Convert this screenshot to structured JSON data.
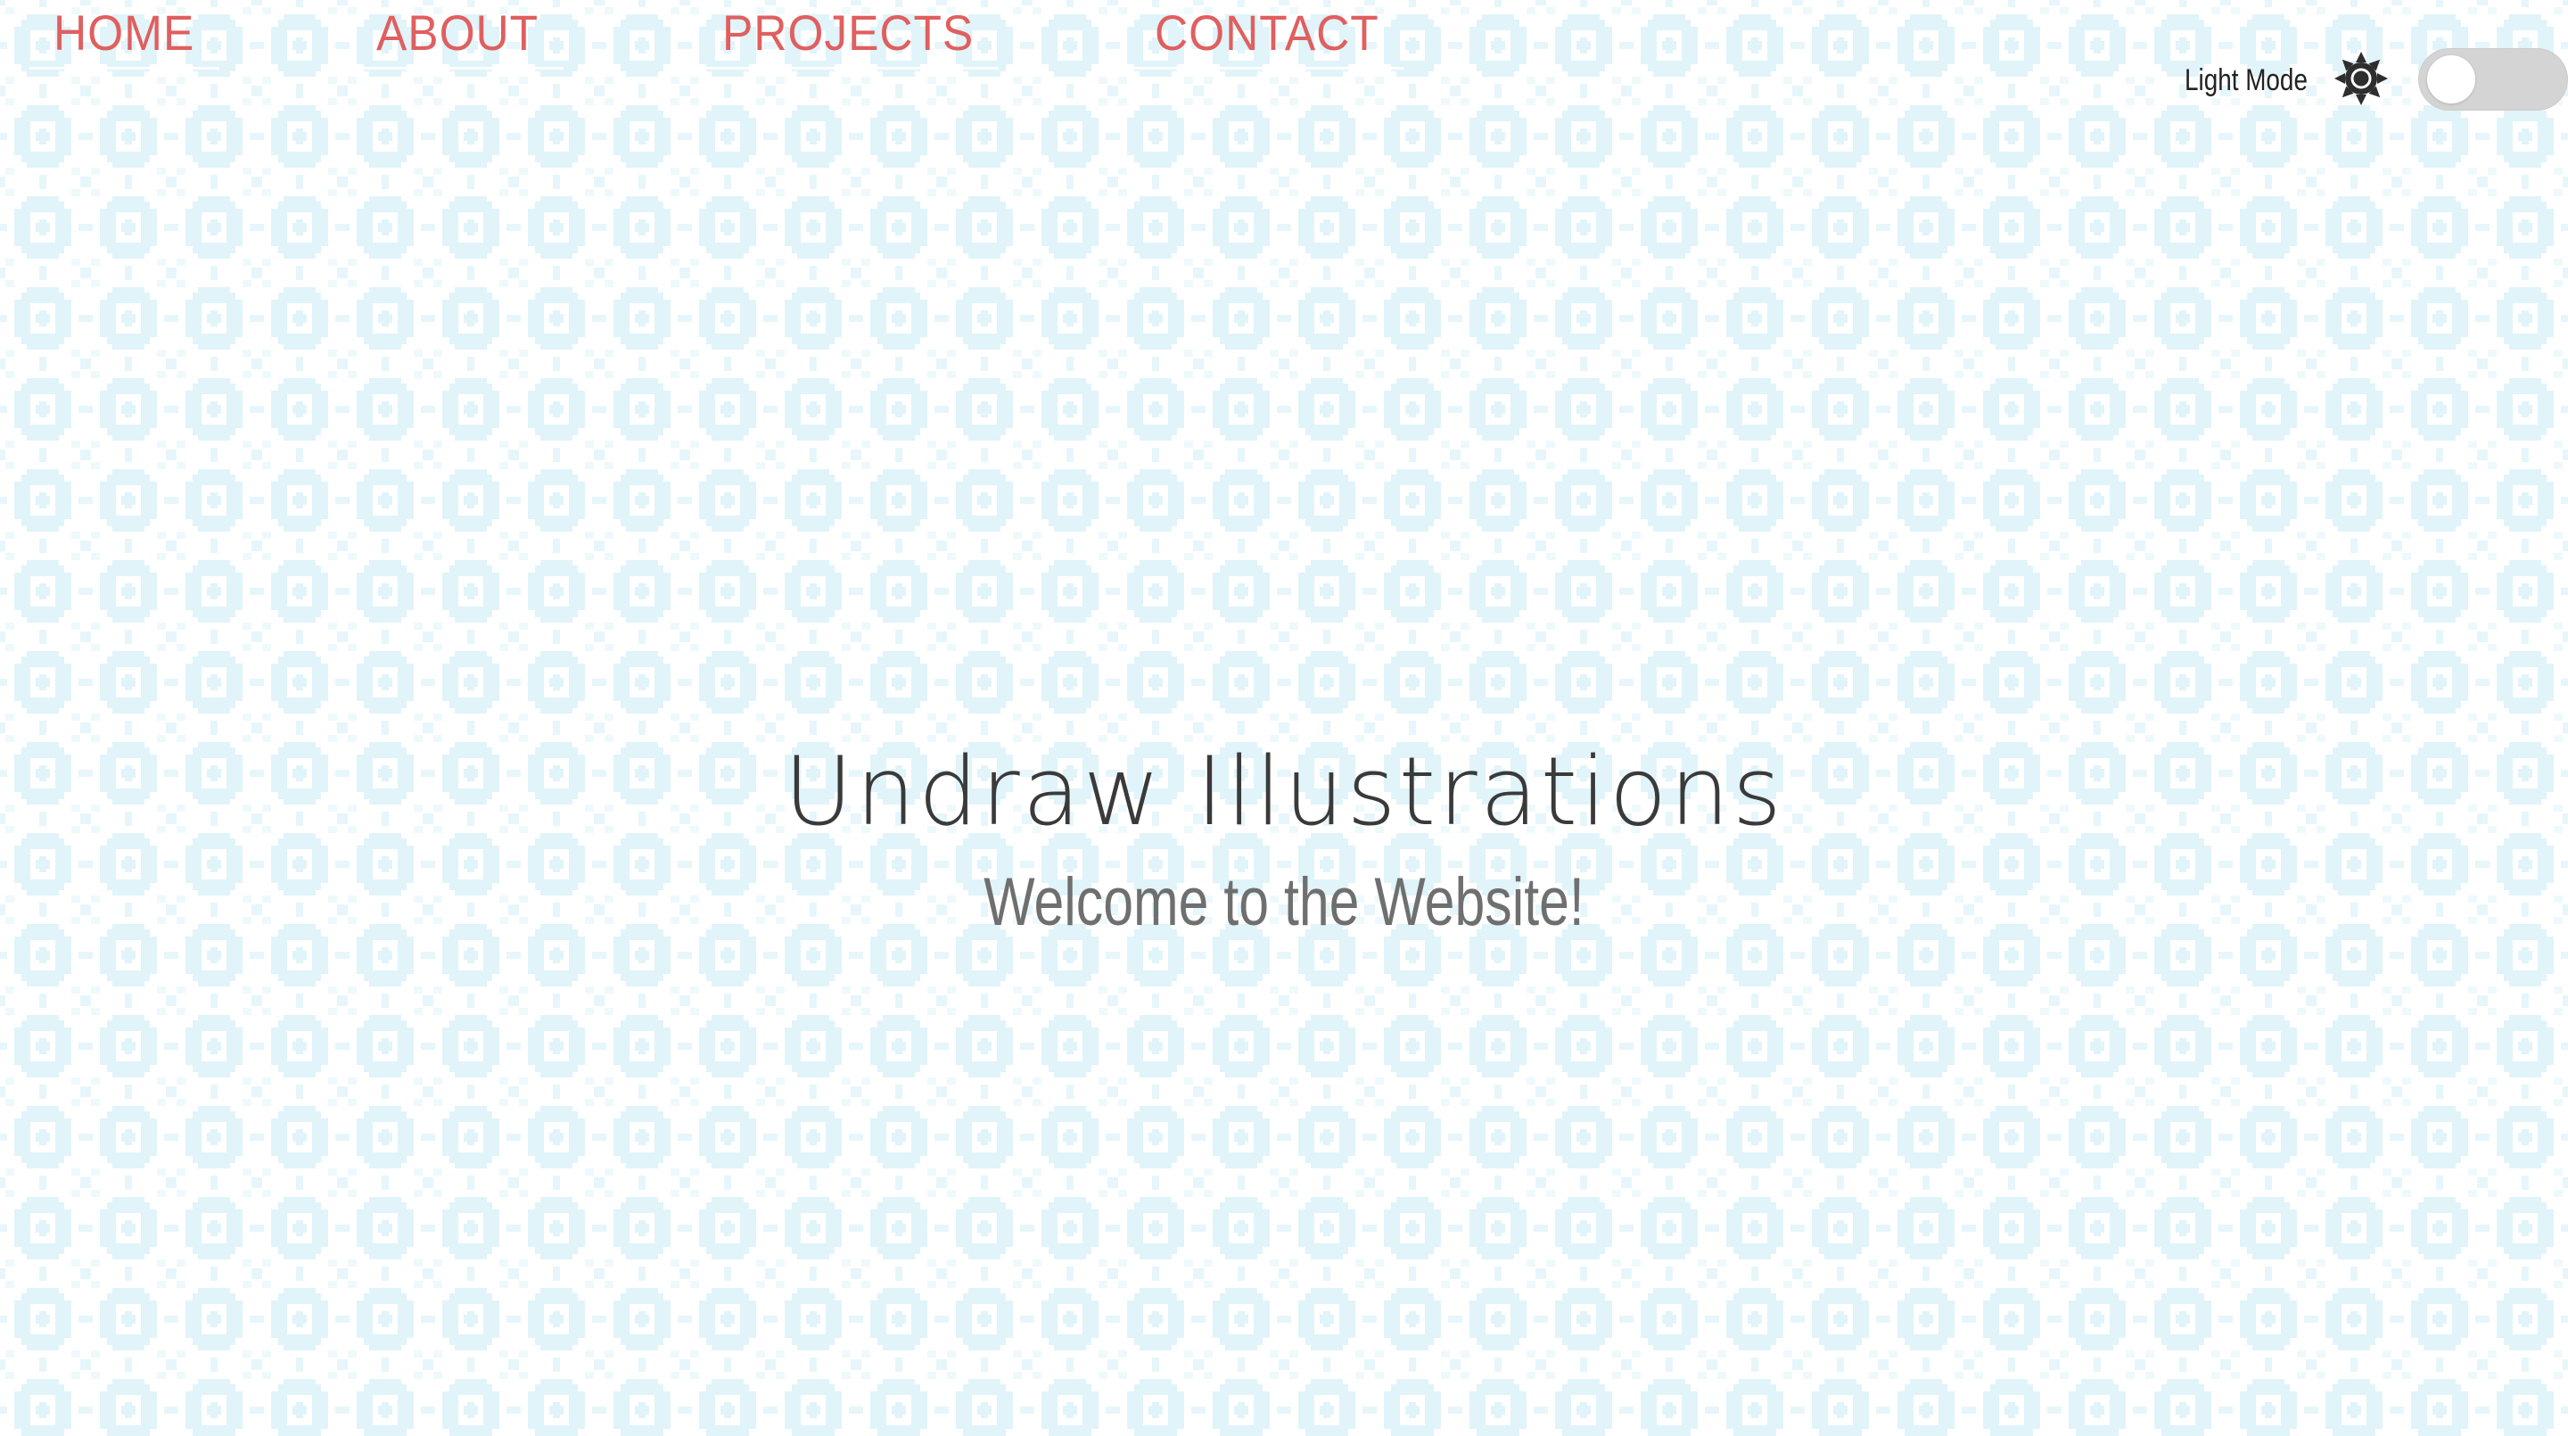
{
  "nav": {
    "items": [
      {
        "label": "HOME"
      },
      {
        "label": "ABOUT"
      },
      {
        "label": "PROJECTS"
      },
      {
        "label": "CONTACT"
      }
    ]
  },
  "theme": {
    "mode_label": "Light Mode",
    "icon": "sun-icon",
    "toggle_on": false
  },
  "hero": {
    "title": "Undraw Illustrations",
    "subtitle": "Welcome to the Website!"
  },
  "colors": {
    "nav_link": "#e05f5f",
    "pattern": "#dff3f9",
    "title": "#3a3a3a",
    "subtitle": "#6f6f6f",
    "toggle_track": "#d4d4d4"
  }
}
